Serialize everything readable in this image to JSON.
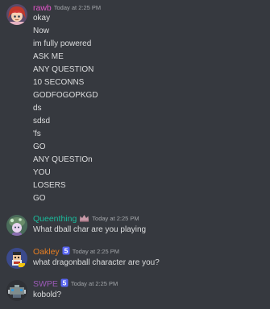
{
  "colors": {
    "background": "#36393f",
    "text": "#dcddde",
    "timestamp": "#a3a6aa",
    "rawb": "#e255c9",
    "queenthing": "#1abc9c",
    "oakley": "#e67e22",
    "swpe": "#9b59b6"
  },
  "messages": [
    {
      "username": "rawb",
      "timestamp": "Today at 2:25 PM",
      "avatar_icon": "anime-character-avatar",
      "lines": [
        "okay",
        "Now",
        "im fully powered",
        "ASK ME",
        "ANY QUESTION",
        "10 SECONNS",
        "GODFOGOPKGD",
        "ds",
        "sdsd",
        "'fs",
        "GO",
        "ANY QUESTIOn",
        "YOU",
        "LOSERS",
        "GO"
      ]
    },
    {
      "username": "Queenthing",
      "timestamp": "Today at 2:25 PM",
      "avatar_icon": "cartoon-character-avatar",
      "badge_icon": "crown-emoji-icon",
      "lines": [
        "What dball char are you playing"
      ]
    },
    {
      "username": "Oakley",
      "timestamp": "Today at 2:25 PM",
      "avatar_icon": "pixel-character-avatar",
      "badge_icon": "number-five-badge-icon",
      "lines": [
        "what dragonball character are you?"
      ]
    },
    {
      "username": "SWPE",
      "timestamp": "Today at 2:25 PM",
      "avatar_icon": "pixel-robot-avatar",
      "badge_icon": "number-five-badge-icon",
      "lines": [
        "kobold?"
      ]
    }
  ]
}
